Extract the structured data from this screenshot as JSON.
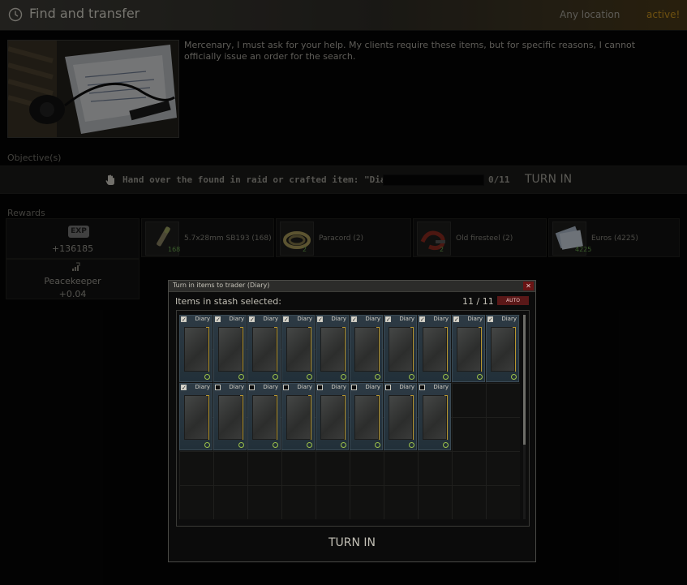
{
  "header": {
    "title": "Find and transfer",
    "location": "Any location",
    "status": "active!"
  },
  "description": "Mercenary, I must ask for your help. My clients require these items, but for specific reasons, I cannot officially issue an order for the search.",
  "objectives": {
    "header": "Objective(s)",
    "items": [
      {
        "text": "Hand over the found in raid or crafted item: \"Diary\"",
        "count": "0/11",
        "progress": 0,
        "action": "TURN IN"
      }
    ]
  },
  "rewards": {
    "header": "Rewards",
    "exp": {
      "badge": "EXP",
      "value": "+136185"
    },
    "reputation": {
      "name": "Peacekeeper",
      "value": "+0.04"
    },
    "items": [
      {
        "name": "5.7x28mm SB193 (168)",
        "count": "168",
        "icon": "ammo-icon"
      },
      {
        "name": "Paracord (2)",
        "count": "2",
        "icon": "paracord-icon"
      },
      {
        "name": "Old firesteel (2)",
        "count": "2",
        "icon": "firesteel-icon"
      },
      {
        "name": "Euros (4225)",
        "count": "4225",
        "icon": "euros-icon"
      }
    ]
  },
  "dialog": {
    "title": "Turn in items to trader (Diary)",
    "close": "✕",
    "subtitle": "Items in stash selected:",
    "count": "11 / 11",
    "auto": "AUTO",
    "turn_in": "TURN IN",
    "items": [
      {
        "label": "Diary",
        "checked": true
      },
      {
        "label": "Diary",
        "checked": true
      },
      {
        "label": "Diary",
        "checked": true
      },
      {
        "label": "Diary",
        "checked": true
      },
      {
        "label": "Diary",
        "checked": true
      },
      {
        "label": "Diary",
        "checked": true
      },
      {
        "label": "Diary",
        "checked": true
      },
      {
        "label": "Diary",
        "checked": true
      },
      {
        "label": "Diary",
        "checked": true
      },
      {
        "label": "Diary",
        "checked": true
      },
      {
        "label": "Diary",
        "checked": true
      },
      {
        "label": "Diary",
        "checked": false
      },
      {
        "label": "Diary",
        "checked": false
      },
      {
        "label": "Diary",
        "checked": false
      },
      {
        "label": "Diary",
        "checked": false
      },
      {
        "label": "Diary",
        "checked": false
      },
      {
        "label": "Diary",
        "checked": false
      },
      {
        "label": "Diary",
        "checked": false
      }
    ]
  },
  "colors": {
    "accent": "#c8921e",
    "item_bg": "#2d3a44",
    "close_red": "#6a1414",
    "fir_green": "#9dc24a"
  }
}
